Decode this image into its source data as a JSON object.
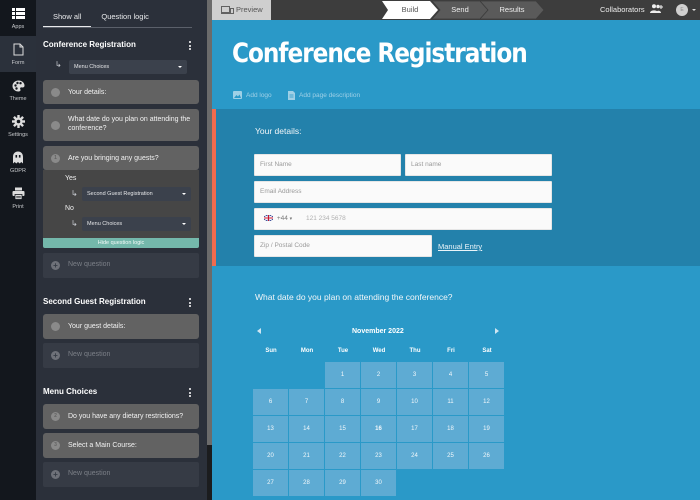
{
  "nav_rail": {
    "items": [
      {
        "label": "Apps",
        "icon": "apps-icon"
      },
      {
        "label": "Form",
        "icon": "form-icon",
        "active": true
      },
      {
        "label": "Theme",
        "icon": "palette-icon"
      },
      {
        "label": "Settings",
        "icon": "gear-icon"
      },
      {
        "label": "GDPR",
        "icon": "ghost-icon"
      },
      {
        "label": "Print",
        "icon": "printer-icon"
      }
    ]
  },
  "panel": {
    "tabs": [
      {
        "label": "Show all",
        "active": true
      },
      {
        "label": "Question logic",
        "active": false
      }
    ],
    "sections": [
      {
        "title": "Conference Registration",
        "goto": "Menu Choices",
        "questions": [
          {
            "number": "",
            "text": "Your details:"
          },
          {
            "number": "",
            "text": "What date do you plan on attending the conference?"
          },
          {
            "number": "1",
            "text": "Are you bringing any guests?"
          }
        ],
        "logic": {
          "yes_label": "Yes",
          "yes_target": "Second Guest Registration",
          "no_label": "No",
          "no_target": "Menu Choices",
          "hide_label": "Hide question logic"
        },
        "new_question": "New question"
      },
      {
        "title": "Second Guest Registration",
        "questions": [
          {
            "number": "",
            "text": "Your guest details:"
          }
        ],
        "new_question": "New question"
      },
      {
        "title": "Menu Choices",
        "questions": [
          {
            "number": "2",
            "text": "Do you have any dietary restrictions?"
          },
          {
            "number": "3",
            "text": "Select a Main Course:"
          }
        ],
        "new_question": "New question"
      }
    ]
  },
  "topbar": {
    "preview_label": "Preview",
    "steps": [
      {
        "label": "Build",
        "active": true
      },
      {
        "label": "Send",
        "active": false
      },
      {
        "label": "Results",
        "active": false
      }
    ],
    "collaborators_label": "Collaborators",
    "avatar_initial": "E"
  },
  "form": {
    "title": "Conference Registration",
    "add_logo": "Add logo",
    "add_description": "Add page description",
    "details_label": "Your details:",
    "fields": {
      "first_name": "First Name",
      "last_name": "Last name",
      "email": "Email Address",
      "phone_code": "+44",
      "phone_placeholder": "121 234 5678",
      "zip": "Zip / Postal Code"
    },
    "manual_entry": "Manual Entry",
    "date_question": "What date do you plan on attending the conference?",
    "calendar": {
      "month_label": "November  2022",
      "weekdays": [
        "Sun",
        "Mon",
        "Tue",
        "Wed",
        "Thu",
        "Fri",
        "Sat"
      ],
      "first_weekday_index": 2,
      "days": [
        "1",
        "2",
        "3",
        "4",
        "5",
        "6",
        "7",
        "8",
        "9",
        "10",
        "11",
        "12",
        "13",
        "14",
        "15",
        "16",
        "17",
        "18",
        "19",
        "20",
        "21",
        "22",
        "23",
        "24",
        "25",
        "26",
        "27",
        "28",
        "29",
        "30"
      ],
      "highlighted_day": "16"
    }
  },
  "colors": {
    "form_bg": "#2a99c8",
    "section_active_bg": "#2381ab",
    "accent_bar": "#f26b4e",
    "logic_button": "#74b8ab",
    "calendar_cell": "#5eabd3"
  }
}
